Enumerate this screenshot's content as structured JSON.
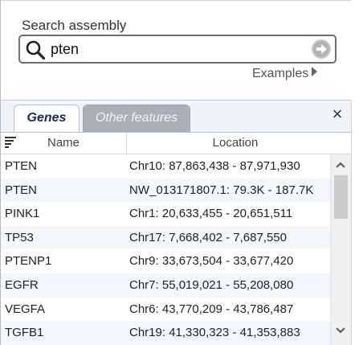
{
  "search": {
    "label": "Search assembly",
    "value": "pten",
    "examples_label": "Examples"
  },
  "tabs": [
    {
      "label": "Genes",
      "active": true
    },
    {
      "label": "Other features",
      "active": false
    }
  ],
  "close_symbol": "×",
  "table": {
    "columns": [
      "Name",
      "Location"
    ],
    "rows": [
      {
        "name": "PTEN",
        "location": "Chr10: 87,863,438 - 87,971,930"
      },
      {
        "name": "PTEN",
        "location": "NW_013171807.1: 79.3K - 187.7K"
      },
      {
        "name": "PINK1",
        "location": "Chr1: 20,633,455 - 20,651,511"
      },
      {
        "name": "TP53",
        "location": "Chr17: 7,668,402 - 7,687,550"
      },
      {
        "name": "PTENP1",
        "location": "Chr9: 33,673,504 - 33,677,420"
      },
      {
        "name": "EGFR",
        "location": "Chr7: 55,019,021 - 55,208,080"
      },
      {
        "name": "VEGFA",
        "location": "Chr6: 43,770,209 - 43,786,487"
      },
      {
        "name": "TGFB1",
        "location": "Chr19: 41,330,323 - 41,353,883"
      }
    ]
  },
  "icons": {
    "search": "magnifier-icon",
    "go": "arrow-right-circle-icon",
    "examples_arrow": "triangle-right-icon",
    "sort_menu": "sort-lines-icon",
    "scroll_up": "chevron-up-icon",
    "scroll_down": "chevron-down-icon"
  },
  "colors": {
    "active_tab_text": "#1c2a5e",
    "inactive_tab_bg": "#aab0b6",
    "tabs_bar_bg": "#eef3f8",
    "zebra_row": "#f3f7fb"
  }
}
